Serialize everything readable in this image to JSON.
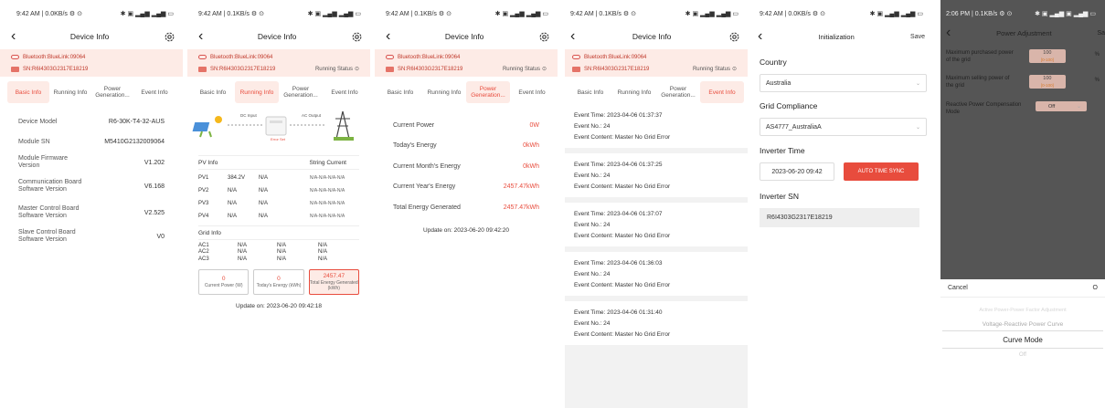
{
  "screen1": {
    "status": {
      "left": "9:42 AM | 0.0KB/s ⚙ ⊙",
      "right": "✱ ▣ ▂▄▆ ▂▄▆ ▭"
    },
    "title": "Device Info",
    "bluetooth": "Bluetooth:BlueLink:09064",
    "sn": "SN:R6I4303G2317E18219",
    "tabs": [
      "Basic Info",
      "Running Info",
      "Power Generation...",
      "Event Info"
    ],
    "rows": [
      {
        "k": "Device Model",
        "v": "R6-30K-T4-32-AUS"
      },
      {
        "k": "Module SN",
        "v": "M5410G2132009064"
      },
      {
        "k": "Module Firmware Version",
        "v": "V1.202"
      },
      {
        "k": "Communication Board Software Version",
        "v": "V6.168"
      },
      {
        "k": "Master Control Board Software Version",
        "v": "V2.525"
      },
      {
        "k": "Slave Control Board Software Version",
        "v": "V0"
      }
    ]
  },
  "screen2": {
    "status": {
      "left": "9:42 AM | 0.1KB/s ⚙ ⊙",
      "right": "✱ ▣ ▂▄▆ ▂▄▆ ▭"
    },
    "title": "Device Info",
    "bluetooth": "Bluetooth:BlueLink:09064",
    "sn": "SN:R6I4303G2317E18219",
    "running_status": "Running Status",
    "tabs": [
      "Basic Info",
      "Running Info",
      "Power Generation...",
      "Event Info"
    ],
    "diagram": {
      "dc": "DC Input",
      "ac": "AC Output",
      "err": "Error Set"
    },
    "pv_title": "PV Info",
    "string_current": "String Current",
    "pv": [
      {
        "name": "PV1",
        "v": "384.2V",
        "i": "N/A",
        "s": "N/A-N/A-N/A-N/A"
      },
      {
        "name": "PV2",
        "v": "N/A",
        "i": "N/A",
        "s": "N/A-N/A-N/A-N/A"
      },
      {
        "name": "PV3",
        "v": "N/A",
        "i": "N/A",
        "s": "N/A-N/A-N/A-N/A"
      },
      {
        "name": "PV4",
        "v": "N/A",
        "i": "N/A",
        "s": "N/A-N/A-N/A-N/A"
      }
    ],
    "grid_title": "Grid Info",
    "grid": [
      {
        "name": "AC1",
        "a": "N/A",
        "b": "N/A",
        "c": "N/A"
      },
      {
        "name": "AC2",
        "a": "N/A",
        "b": "N/A",
        "c": "N/A"
      },
      {
        "name": "AC3",
        "a": "N/A",
        "b": "N/A",
        "c": "N/A"
      }
    ],
    "stats": [
      {
        "n": "0",
        "l": "Current Power (W)"
      },
      {
        "n": "0",
        "l": "Today's Energy (kWh)"
      },
      {
        "n": "2457.47",
        "l": "Total Energy Generated (kWh)"
      }
    ],
    "update": "Update on: 2023-06-20 09:42:18"
  },
  "screen3": {
    "status": {
      "left": "9:42 AM | 0.1KB/s ⚙ ⊙",
      "right": "✱ ▣ ▂▄▆ ▂▄▆ ▭"
    },
    "title": "Device Info",
    "bluetooth": "Bluetooth:BlueLink:09064",
    "sn": "SN:R6I4303G2317E18219",
    "running_status": "Running Status",
    "tabs": [
      "Basic Info",
      "Running Info",
      "Power Generation...",
      "Event Info"
    ],
    "rows": [
      {
        "k": "Current Power",
        "v": "0W"
      },
      {
        "k": "Today's Energy",
        "v": "0kWh"
      },
      {
        "k": "Current Month's Energy",
        "v": "0kWh"
      },
      {
        "k": "Current Year's Energy",
        "v": "2457.47kWh"
      },
      {
        "k": "Total Energy Generated",
        "v": "2457.47kWh"
      }
    ],
    "update": "Update on: 2023-06-20 09:42:20"
  },
  "screen4": {
    "status": {
      "left": "9:42 AM | 0.1KB/s ⚙ ⊙",
      "right": "✱ ▣ ▂▄▆ ▂▄▆ ▭"
    },
    "title": "Device Info",
    "bluetooth": "Bluetooth:BlueLink:09064",
    "sn": "SN:R6I4303G2317E18219",
    "running_status": "Running Status",
    "tabs": [
      "Basic Info",
      "Running Info",
      "Power Generation...",
      "Event Info"
    ],
    "events": [
      {
        "time": "Event Time:  2023-04-06 01:37:37",
        "no": "Event No.:  24",
        "content": "Event Content:  Master No Grid Error"
      },
      {
        "time": "Event Time:  2023-04-06 01:37:25",
        "no": "Event No.:  24",
        "content": "Event Content:  Master No Grid Error"
      },
      {
        "time": "Event Time:  2023-04-06 01:37:07",
        "no": "Event No.:  24",
        "content": "Event Content:  Master No Grid Error"
      },
      {
        "time": "Event Time:  2023-04-06 01:36:03",
        "no": "Event No.:  24",
        "content": "Event Content:  Master No Grid Error"
      },
      {
        "time": "Event Time:  2023-04-06 01:31:40",
        "no": "Event No.:  24",
        "content": "Event Content:  Master No Grid Error"
      }
    ]
  },
  "screen5": {
    "status": {
      "left": "9:42 AM | 0.0KB/s ⚙ ⊙",
      "right": "✱ ▣ ▂▄▆ ▂▄▆ ▭"
    },
    "title": "Initialization",
    "save": "Save",
    "country_label": "Country",
    "country": "Australia",
    "grid_label": "Grid Compliance",
    "grid": "AS4777_AustraliaA",
    "time_label": "Inverter Time",
    "time": "2023-06-20 09:42",
    "sync": "AUTO TIME SYNC",
    "sn_label": "Inverter SN",
    "sn": "R6I4303G2317E18219"
  },
  "screen6": {
    "status": {
      "left": "2:06 PM | 0.1KB/s ⚙ ⊙",
      "right": "✱ ▣ ▂▄▆ ▣ ▂▄▆ ▭"
    },
    "title": "Power Adjustment",
    "save": "Sa",
    "rows": [
      {
        "label": "Maximum purchased power of the grid",
        "value": "100",
        "range": "[0-100]",
        "unit": "%"
      },
      {
        "label": "Maximum selling power of the grid",
        "value": "100",
        "range": "[0-100]",
        "unit": "%"
      }
    ],
    "reactive_label": "Reactive Power Compensation Mode",
    "reactive_value": "Off",
    "sheet": {
      "cancel": "Cancel",
      "ok": "O",
      "options": [
        "Active Power-Power Factor Adjustment",
        "Voltage-Reactive Power Curve",
        "Curve Mode",
        "Off"
      ]
    }
  }
}
